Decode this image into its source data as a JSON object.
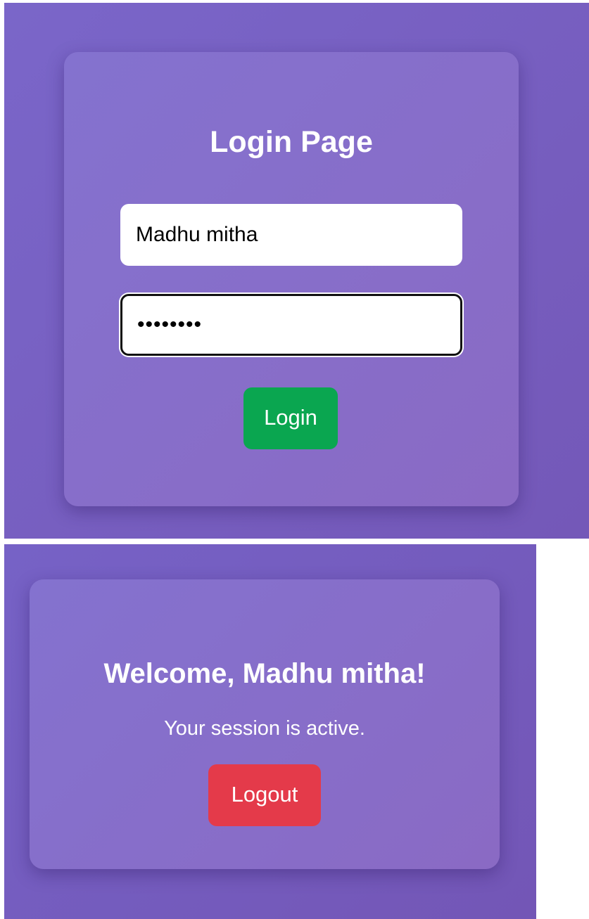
{
  "login_screen": {
    "title": "Login Page",
    "username_value": "Madhu mitha",
    "password_masked": "••••••••",
    "login_button": "Login",
    "colors": {
      "background": "#7660c4",
      "card": "#8670cc",
      "login_button": "#0aa650"
    }
  },
  "welcome_screen": {
    "title": "Welcome, Madhu mitha!",
    "status_text": "Your session is active.",
    "logout_button": "Logout",
    "colors": {
      "background": "#745cc0",
      "card": "#8670cc",
      "logout_button": "#e43a4a"
    }
  }
}
